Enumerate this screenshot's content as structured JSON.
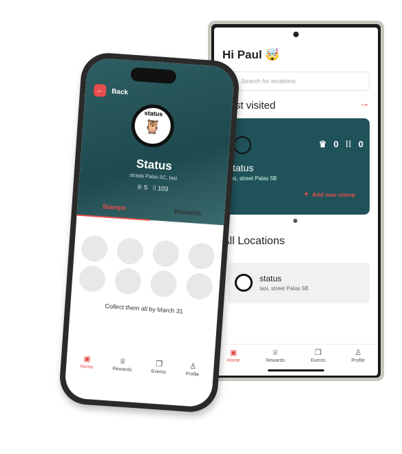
{
  "home": {
    "greeting": "Hi Paul 🤯",
    "search_placeholder": "Search for locations",
    "most_visited": "Most visited",
    "featured": {
      "name": "status",
      "address": "Iasi, street Palas 5B",
      "rewards": "0",
      "stamps": "0",
      "add_stamp": "Add new stamp"
    },
    "all_locations": "All Locations",
    "locations": [
      {
        "name": "status",
        "address": "Iasi, street Palas 5B"
      }
    ]
  },
  "nav": [
    {
      "label": "Home",
      "icon": "home-icon",
      "active": true
    },
    {
      "label": "Rewards",
      "icon": "crown-icon"
    },
    {
      "label": "Events",
      "icon": "events-icon"
    },
    {
      "label": "Profile",
      "icon": "profile-icon"
    }
  ],
  "detail": {
    "back": "Back",
    "logo_text": "status",
    "logo_sub": "coffee",
    "name": "Status",
    "address": "strada Palas 5C, Iasi",
    "rewards": "5",
    "stamps": "103",
    "tabs": [
      "Stamps",
      "Rewards"
    ],
    "collect_text": "Collect them all by March 31"
  },
  "colors": {
    "accent": "#e84c4c",
    "teal": "#1f5259"
  }
}
